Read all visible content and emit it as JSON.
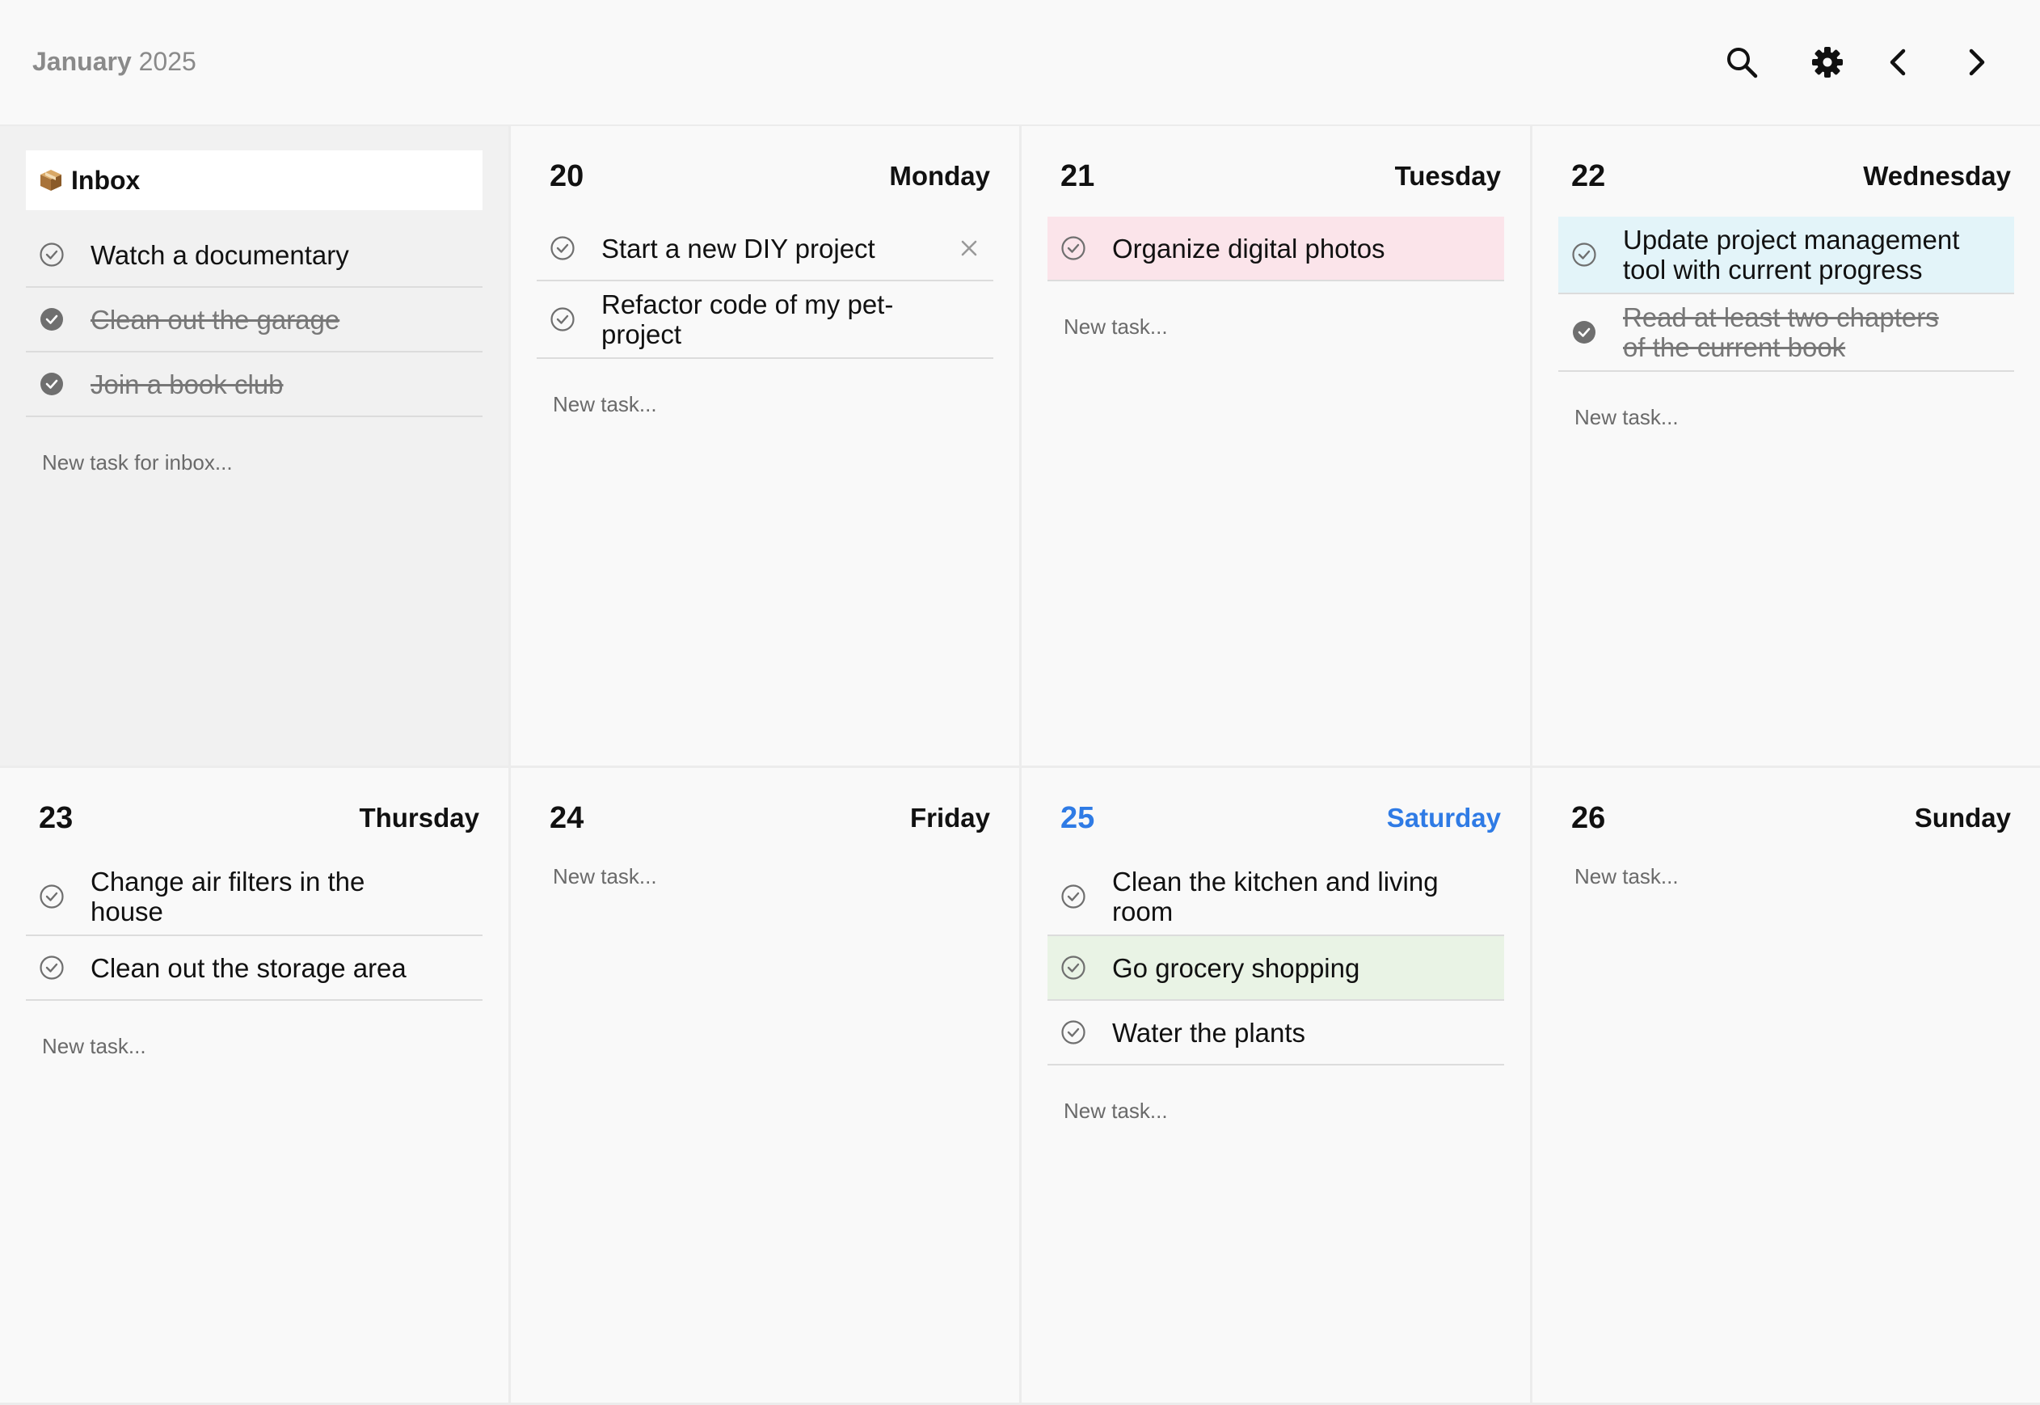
{
  "header": {
    "month": "January",
    "year": "2025"
  },
  "toolbar": {
    "icons": [
      "search-icon",
      "gear-icon",
      "chevron-left-icon",
      "chevron-right-icon"
    ]
  },
  "colors": {
    "accent": "#2f7be5",
    "pink": "#fbe4ea",
    "blue": "#e3f4f9",
    "green": "#e9f3e5"
  },
  "inbox": {
    "title": "Inbox",
    "tasks": [
      {
        "text": "Watch a documentary",
        "done": false
      },
      {
        "text": "Clean out the garage",
        "done": true
      },
      {
        "text": "Join a book club",
        "done": true
      }
    ],
    "placeholder": "New task for inbox..."
  },
  "days": [
    {
      "num": "20",
      "name": "Monday",
      "today": false,
      "tasks": [
        {
          "text": "Start a new DIY project",
          "done": false,
          "color": "",
          "deletable": true
        },
        {
          "text": "Refactor code of my pet-project",
          "done": false,
          "color": ""
        }
      ],
      "placeholder": "New task..."
    },
    {
      "num": "21",
      "name": "Tuesday",
      "today": false,
      "tasks": [
        {
          "text": "Organize digital photos",
          "done": false,
          "color": "pink"
        }
      ],
      "placeholder": "New task..."
    },
    {
      "num": "22",
      "name": "Wednesday",
      "today": false,
      "tasks": [
        {
          "text": "Update project management tool with current progress",
          "done": false,
          "color": "blue"
        },
        {
          "text": "Read at least two chapters of the current book",
          "done": true,
          "color": ""
        }
      ],
      "placeholder": "New task..."
    },
    {
      "num": "23",
      "name": "Thursday",
      "today": false,
      "tasks": [
        {
          "text": "Change air filters in the house",
          "done": false,
          "color": ""
        },
        {
          "text": "Clean out the storage area",
          "done": false,
          "color": ""
        }
      ],
      "placeholder": "New task..."
    },
    {
      "num": "24",
      "name": "Friday",
      "today": false,
      "tasks": [],
      "placeholder": "New task..."
    },
    {
      "num": "25",
      "name": "Saturday",
      "today": true,
      "tasks": [
        {
          "text": "Clean the kitchen and living room",
          "done": false,
          "color": ""
        },
        {
          "text": "Go grocery shopping",
          "done": false,
          "color": "green"
        },
        {
          "text": "Water the plants",
          "done": false,
          "color": ""
        }
      ],
      "placeholder": "New task..."
    },
    {
      "num": "26",
      "name": "Sunday",
      "today": false,
      "tasks": [],
      "placeholder": "New task..."
    }
  ]
}
